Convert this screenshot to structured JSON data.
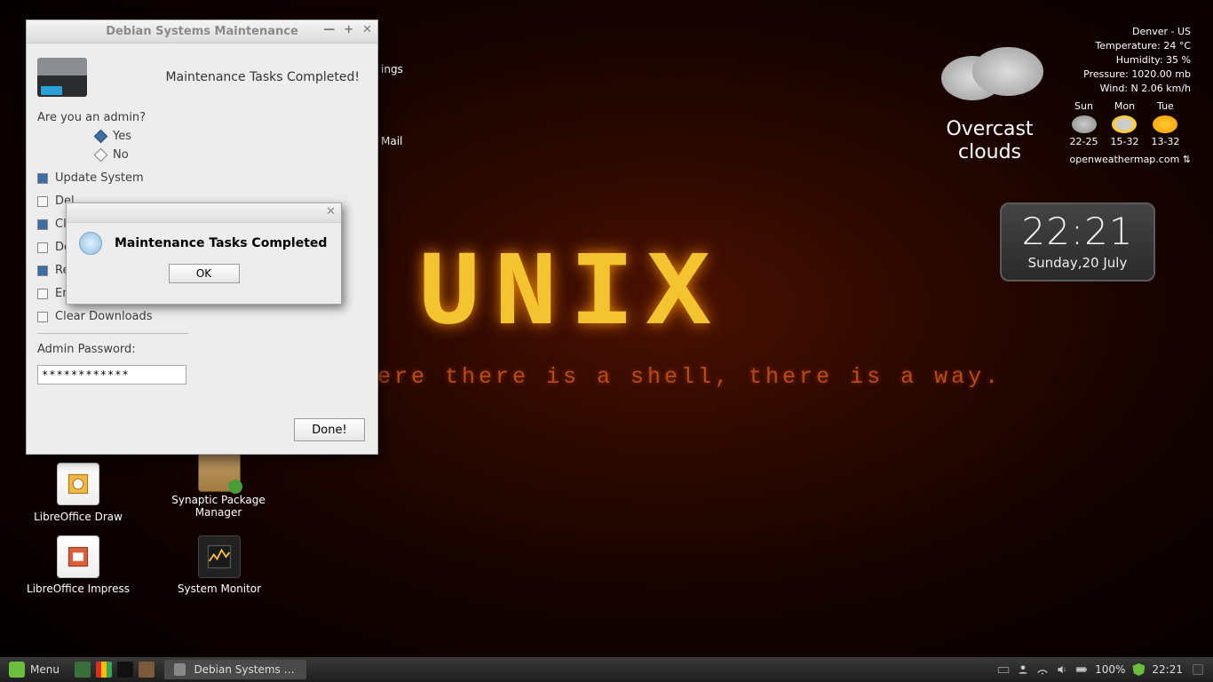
{
  "wallpaper": {
    "title": "UNIX",
    "subtitle": "ere there is a shell, there is a way."
  },
  "desktop_hidden": {
    "settings": "ings",
    "mail": "Mail"
  },
  "icons": {
    "draw": "LibreOffice Draw",
    "impress": "LibreOffice Impress",
    "synaptic": "Synaptic Package Manager",
    "sysmon": "System Monitor"
  },
  "weather": {
    "location": "Denver - US",
    "temp": "Temperature: 24 °C",
    "humidity": "Humidity: 35 %",
    "pressure": "Pressure: 1020.00 mb",
    "wind": "Wind: N 2.06 km/h",
    "condition": "Overcast clouds",
    "forecast": [
      {
        "day": "Sun",
        "range": "22-25"
      },
      {
        "day": "Mon",
        "range": "15-32"
      },
      {
        "day": "Tue",
        "range": "13-32"
      }
    ],
    "attribution": "openweathermap.com ⇅"
  },
  "clock": {
    "time": "22:21",
    "date": "Sunday,20 July"
  },
  "maint_window": {
    "title": "Debian Systems Maintenance",
    "hero": "Maintenance Tasks Completed!",
    "admin_q": "Are you an admin?",
    "yes": "Yes",
    "no": "No",
    "tasks": {
      "update": "Update System",
      "del1": "Del",
      "clear1": "Cle",
      "del2": "Del",
      "remove": "Rem",
      "empty_trash": "Empty Trash",
      "clear_downloads": "Clear Downloads"
    },
    "pwd_label": "Admin Password:",
    "pwd_value": "************",
    "done": "Done!"
  },
  "dialog": {
    "message": "Maintenance Tasks Completed",
    "ok": "OK"
  },
  "taskbar": {
    "menu": "Menu",
    "task": "Debian Systems M...",
    "battery": "100%",
    "clock": "22:21"
  }
}
